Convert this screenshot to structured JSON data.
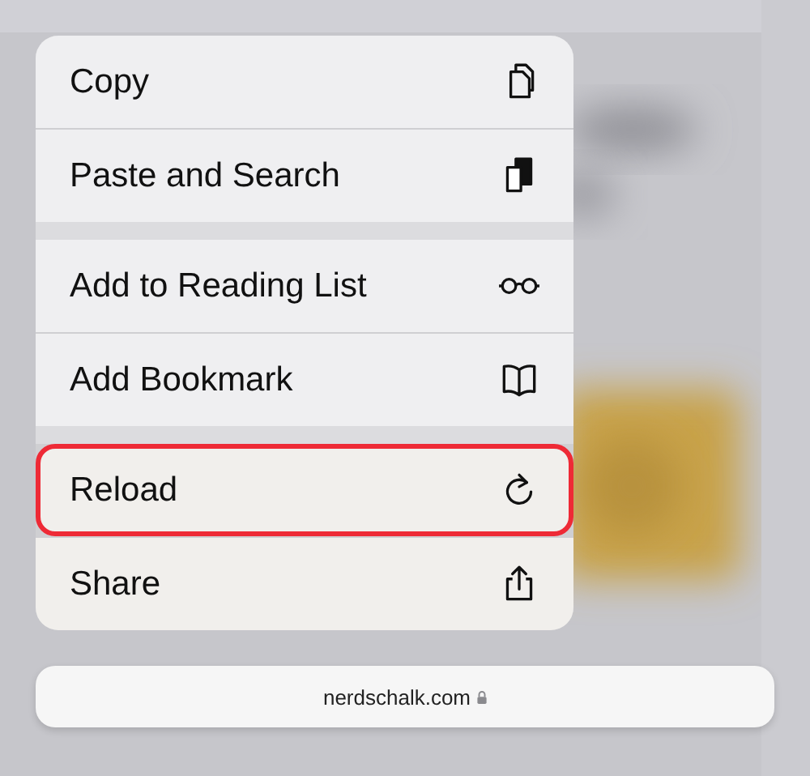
{
  "menu": {
    "sections": [
      {
        "items": [
          {
            "label": "Copy",
            "kind": "copy",
            "highlighted": false
          },
          {
            "label": "Paste and Search",
            "kind": "paste",
            "highlighted": false
          }
        ]
      },
      {
        "items": [
          {
            "label": "Add to Reading List",
            "kind": "glasses",
            "highlighted": false
          },
          {
            "label": "Add Bookmark",
            "kind": "book",
            "highlighted": false
          }
        ]
      },
      {
        "items": [
          {
            "label": "Reload",
            "kind": "reload",
            "highlighted": true
          },
          {
            "label": "Share",
            "kind": "share",
            "highlighted": false
          }
        ]
      }
    ]
  },
  "address_bar": {
    "url": "nerdschalk.com",
    "secure": true
  }
}
